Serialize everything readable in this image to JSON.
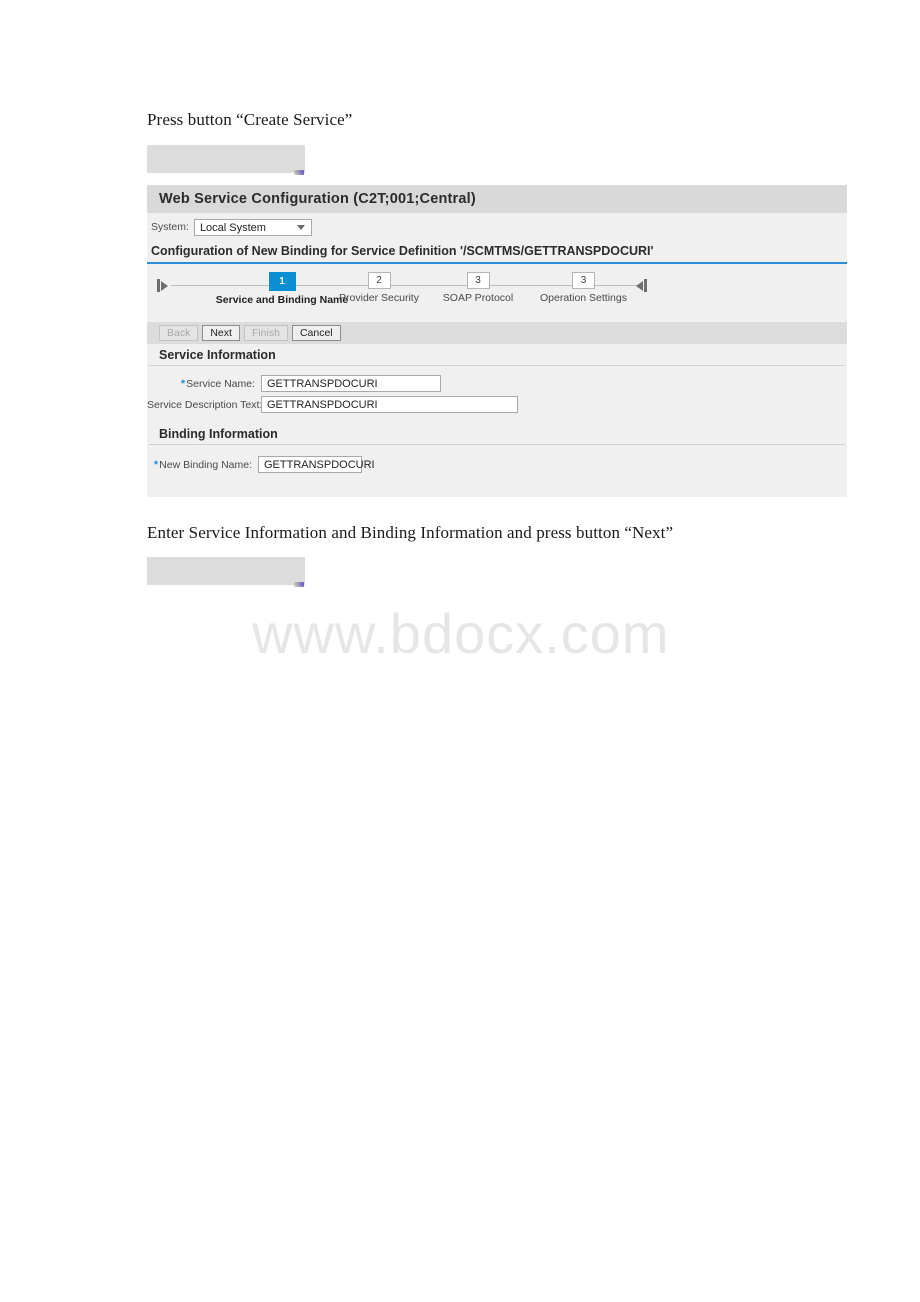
{
  "document": {
    "intro_text": "Press button “Create Service”",
    "middle_text": "Enter Service Information and Binding Information and press button “Next”"
  },
  "watermark": {
    "text": "www.bdocx.com"
  },
  "panel": {
    "title": "Web Service Configuration (C2T;001;Central)",
    "system": {
      "label": "System:",
      "selected": "Local System",
      "caret_icon": "chevron-down-icon"
    },
    "config_heading": "Configuration of New Binding for Service Definition '/SCMTMS/GETTRANSPDOCURI'",
    "accent_color": "#2a8ed8"
  },
  "roadmap": {
    "first_icon": "jump-to-first-icon",
    "last_icon": "jump-to-last-icon",
    "steps": [
      {
        "number": "1",
        "label": "Service and Binding Name",
        "current": true
      },
      {
        "number": "2",
        "label": "Provider Security",
        "current": false
      },
      {
        "number": "3",
        "label": "SOAP Protocol",
        "current": false
      },
      {
        "number": "3",
        "label": "Operation Settings",
        "current": false
      }
    ]
  },
  "toolbar": {
    "back_label": "Back",
    "next_label": "Next",
    "finish_label": "Finish",
    "cancel_label": "Cancel"
  },
  "service_information": {
    "heading": "Service Information",
    "service_name_label": "Service Name:",
    "service_name_value": "GETTRANSPDOCURI",
    "service_description_label": "Service Description Text:",
    "service_description_value": "GETTRANSPDOCURI"
  },
  "binding_information": {
    "heading": "Binding Information",
    "new_binding_name_label": "New Binding Name:",
    "new_binding_name_value": "GETTRANSPDOCURI"
  }
}
